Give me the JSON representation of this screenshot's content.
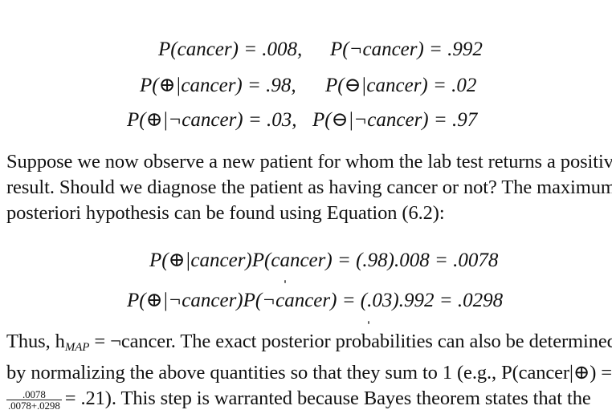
{
  "equations_priors": [
    {
      "left": "P(cancer) = .008,",
      "right": "P(¬cancer) = .992"
    },
    {
      "left": "P(⊕|cancer) = .98,",
      "right": "P(⊖|cancer) = .02"
    },
    {
      "left": "P(⊕|¬cancer) = .03,",
      "right": "P(⊖|¬cancer) = .97"
    }
  ],
  "paragraph1": {
    "lines": [
      "Suppose we now observe a new patient for whom the lab test returns a positive",
      "result. Should we diagnose the patient as having cancer or not? The maximum a",
      "posteriori hypothesis can be found using Equation (6.2):"
    ]
  },
  "equations_map": [
    "P(⊕|cancer)P(cancer) = (.98).008 = .0078",
    "P(⊕|¬cancer)P(¬cancer) = (.03).992 = .0298"
  ],
  "paragraph2": {
    "line1_prefix": "Thus, h",
    "line1_sub": "MAP",
    "line1_suffix": " = ¬cancer. The exact posterior probabilities can also be determined",
    "line2": "by normalizing the above quantities so that they sum to 1 (e.g., P(cancer|⊕) =",
    "frac_num": ".0078",
    "frac_den": ".0078+.0298",
    "line3_suffix": "= .21). This step is warranted because Bayes theorem states that the"
  }
}
